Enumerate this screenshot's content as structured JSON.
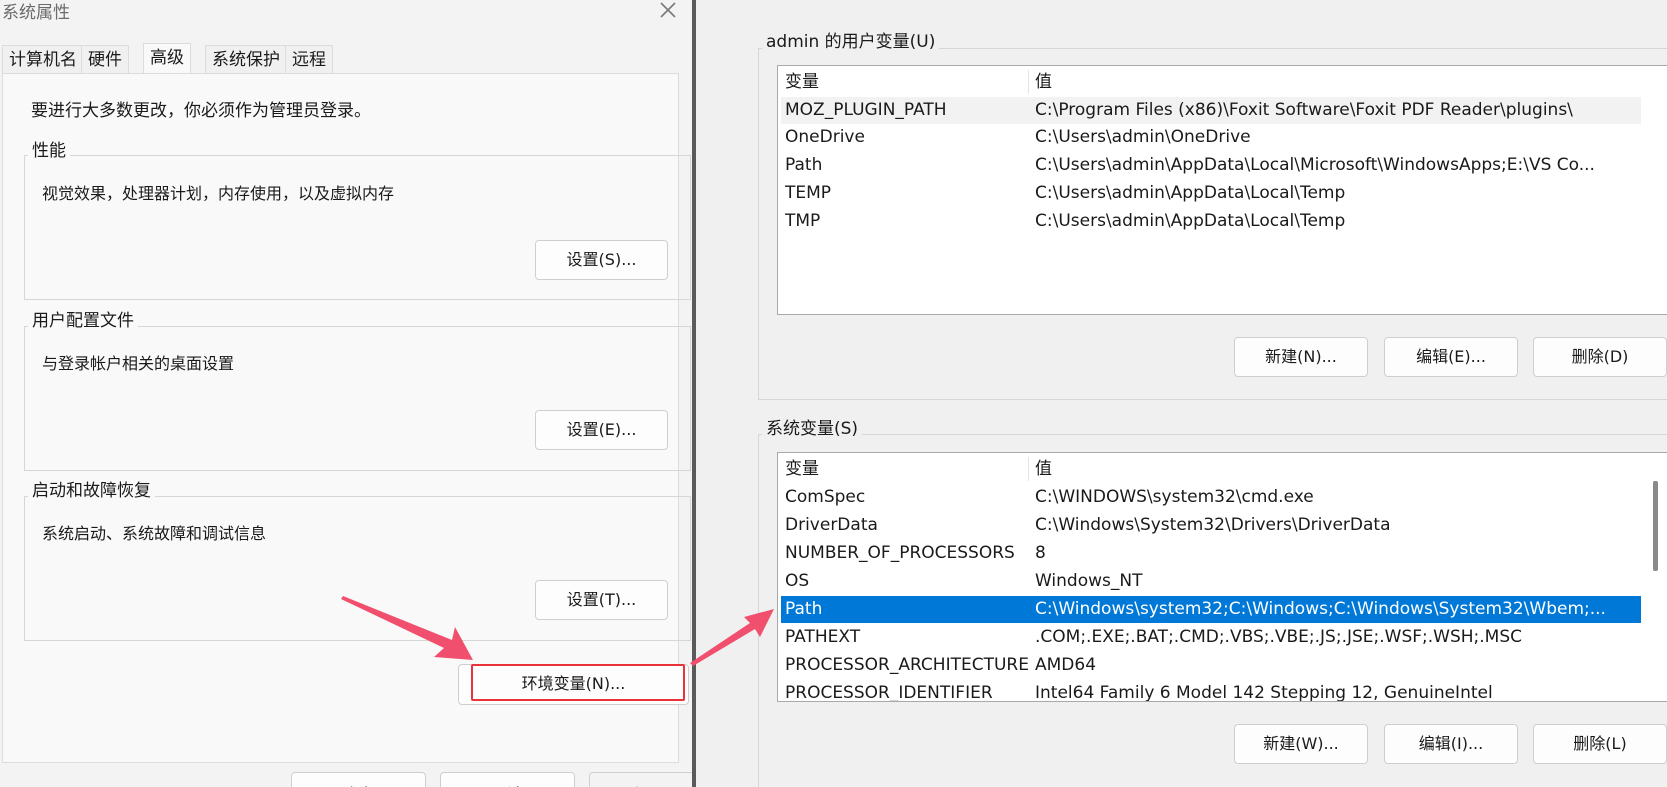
{
  "left_dialog": {
    "title": "系统属性",
    "tabs": [
      "计算机名",
      "硬件",
      "高级",
      "系统保护",
      "远程"
    ],
    "active_tab_index": 2,
    "admin_notice": "要进行大多数更改，你必须作为管理员登录。",
    "groups": [
      {
        "label": "性能",
        "description": "视觉效果，处理器计划，内存使用，以及虚拟内存",
        "button": "设置(S)..."
      },
      {
        "label": "用户配置文件",
        "description": "与登录帐户相关的桌面设置",
        "button": "设置(E)..."
      },
      {
        "label": "启动和故障恢复",
        "description": "系统启动、系统故障和调试信息",
        "button": "设置(T)..."
      }
    ],
    "env_button": "环境变量(N)...",
    "footer_buttons": [
      "确定",
      "取消",
      "应用(A)"
    ]
  },
  "right_dialog": {
    "user_vars": {
      "label": "admin 的用户变量(U)",
      "columns": [
        "变量",
        "值"
      ],
      "rows": [
        {
          "name": "MOZ_PLUGIN_PATH",
          "value": "C:\\Program Files (x86)\\Foxit Software\\Foxit PDF Reader\\plugins\\"
        },
        {
          "name": "OneDrive",
          "value": "C:\\Users\\admin\\OneDrive"
        },
        {
          "name": "Path",
          "value": "C:\\Users\\admin\\AppData\\Local\\Microsoft\\WindowsApps;E:\\VS Co..."
        },
        {
          "name": "TEMP",
          "value": "C:\\Users\\admin\\AppData\\Local\\Temp"
        },
        {
          "name": "TMP",
          "value": "C:\\Users\\admin\\AppData\\Local\\Temp"
        }
      ],
      "buttons": [
        "新建(N)...",
        "编辑(E)...",
        "删除(D)"
      ]
    },
    "system_vars": {
      "label": "系统变量(S)",
      "columns": [
        "变量",
        "值"
      ],
      "rows": [
        {
          "name": "ComSpec",
          "value": "C:\\WINDOWS\\system32\\cmd.exe"
        },
        {
          "name": "DriverData",
          "value": "C:\\Windows\\System32\\Drivers\\DriverData"
        },
        {
          "name": "NUMBER_OF_PROCESSORS",
          "value": "8"
        },
        {
          "name": "OS",
          "value": "Windows_NT"
        },
        {
          "name": "Path",
          "value": "C:\\Windows\\system32;C:\\Windows;C:\\Windows\\System32\\Wbem;..."
        },
        {
          "name": "PATHEXT",
          "value": ".COM;.EXE;.BAT;.CMD;.VBS;.VBE;.JS;.JSE;.WSF;.WSH;.MSC"
        },
        {
          "name": "PROCESSOR_ARCHITECTURE",
          "value": "AMD64"
        },
        {
          "name": "PROCESSOR_IDENTIFIER",
          "value": "Intel64 Family 6 Model 142 Stepping 12, GenuineIntel"
        }
      ],
      "selected_index": 4,
      "buttons": [
        "新建(W)...",
        "编辑(I)...",
        "删除(L)"
      ]
    }
  },
  "colors": {
    "selection": "#0078d7",
    "annotation_arrow": "#f0506e",
    "highlight_box": "#e8333a"
  },
  "icons": [
    "close-icon",
    "annotation-arrow"
  ]
}
